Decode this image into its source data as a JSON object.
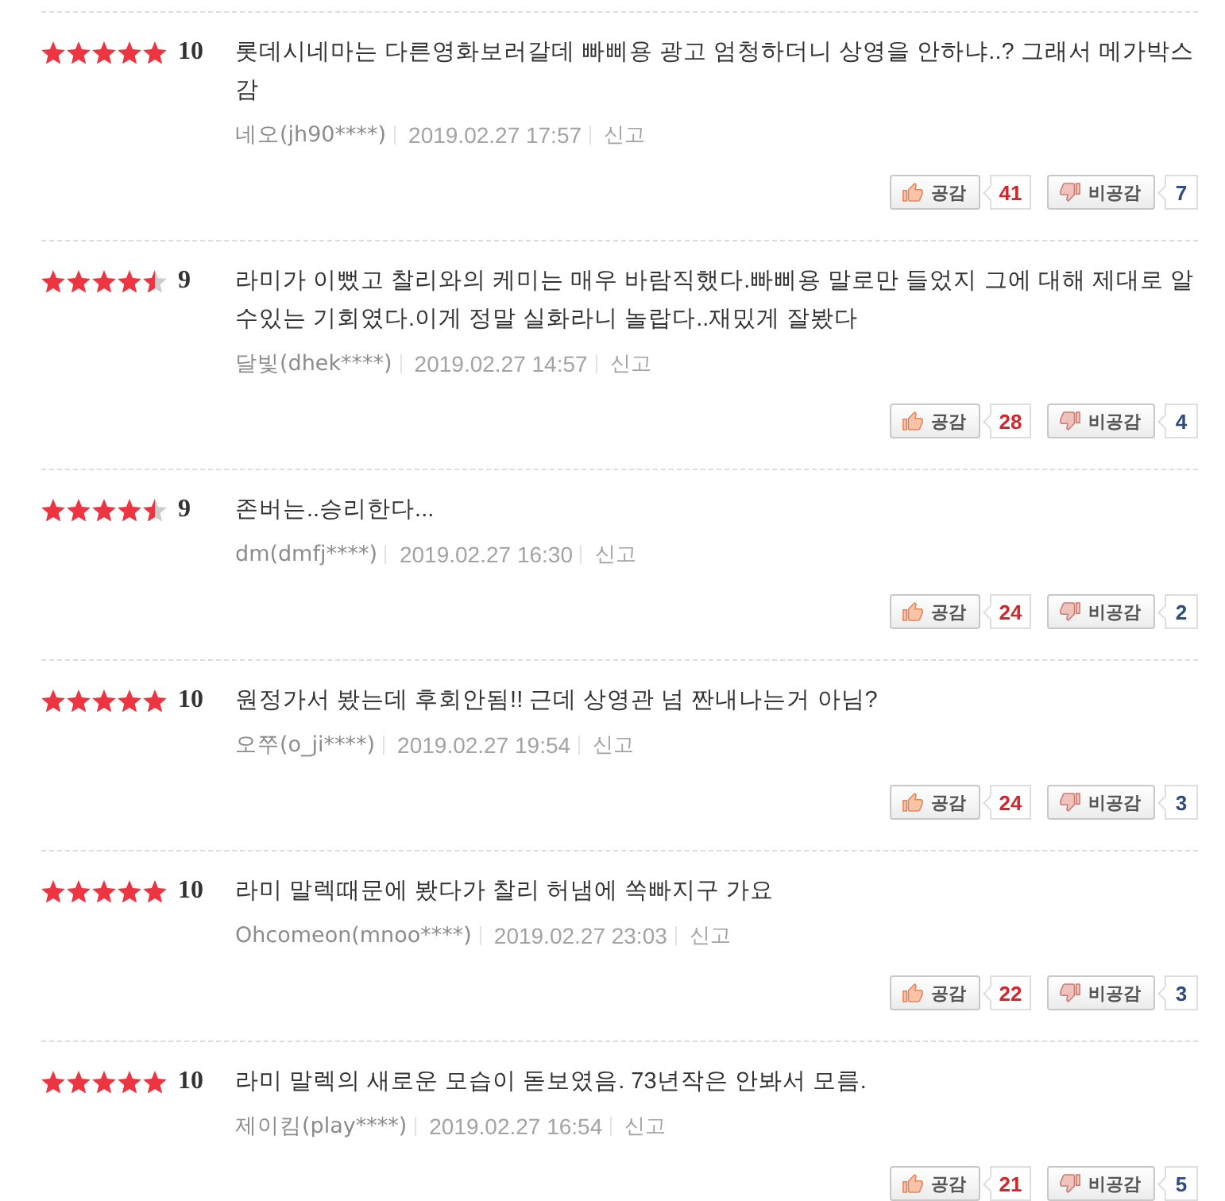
{
  "reviews": [
    {
      "stars": 5,
      "score": "10",
      "text": "롯데시네마는 다른영화보러갈데 빠삐용 광고 엄청하더니 상영을 안하냐..? 그래서 메가박스감",
      "author": "네오(jh90****)",
      "date": "2019.02.27 17:57",
      "report": "신고",
      "like": {
        "label": "공감",
        "count": "41"
      },
      "dislike": {
        "label": "비공감",
        "count": "7"
      }
    },
    {
      "stars": 4.5,
      "score": "9",
      "text": "라미가 이뻤고 찰리와의 케미는 매우 바람직했다.빠삐용 말로만 들었지 그에 대해 제대로 알수있는 기회였다.이게 정말 실화라니 놀랍다..재밌게 잘봤다",
      "author": "달빛(dhek****)",
      "date": "2019.02.27 14:57",
      "report": "신고",
      "like": {
        "label": "공감",
        "count": "28"
      },
      "dislike": {
        "label": "비공감",
        "count": "4"
      }
    },
    {
      "stars": 4.5,
      "score": "9",
      "text": "존버는..승리한다...",
      "author": "dm(dmfj****)",
      "date": "2019.02.27 16:30",
      "report": "신고",
      "like": {
        "label": "공감",
        "count": "24"
      },
      "dislike": {
        "label": "비공감",
        "count": "2"
      }
    },
    {
      "stars": 5,
      "score": "10",
      "text": "원정가서 봤는데 후회안됨!! 근데 상영관 넘 짠내나는거 아님?",
      "author": "오쭈(o_ji****)",
      "date": "2019.02.27 19:54",
      "report": "신고",
      "like": {
        "label": "공감",
        "count": "24"
      },
      "dislike": {
        "label": "비공감",
        "count": "3"
      }
    },
    {
      "stars": 5,
      "score": "10",
      "text": "라미 말렉때문에 봤다가 찰리 허냄에 쏙빠지구 가요",
      "author": "Ohcomeon(mnoo****)",
      "date": "2019.02.27 23:03",
      "report": "신고",
      "like": {
        "label": "공감",
        "count": "22"
      },
      "dislike": {
        "label": "비공감",
        "count": "3"
      }
    },
    {
      "stars": 5,
      "score": "10",
      "text": "라미 말렉의 새로운 모습이 돋보였음. 73년작은 안봐서 모름.",
      "author": "제이킴(play****)",
      "date": "2019.02.27 16:54",
      "report": "신고",
      "like": {
        "label": "공감",
        "count": "21"
      },
      "dislike": {
        "label": "비공감",
        "count": "5"
      }
    }
  ]
}
